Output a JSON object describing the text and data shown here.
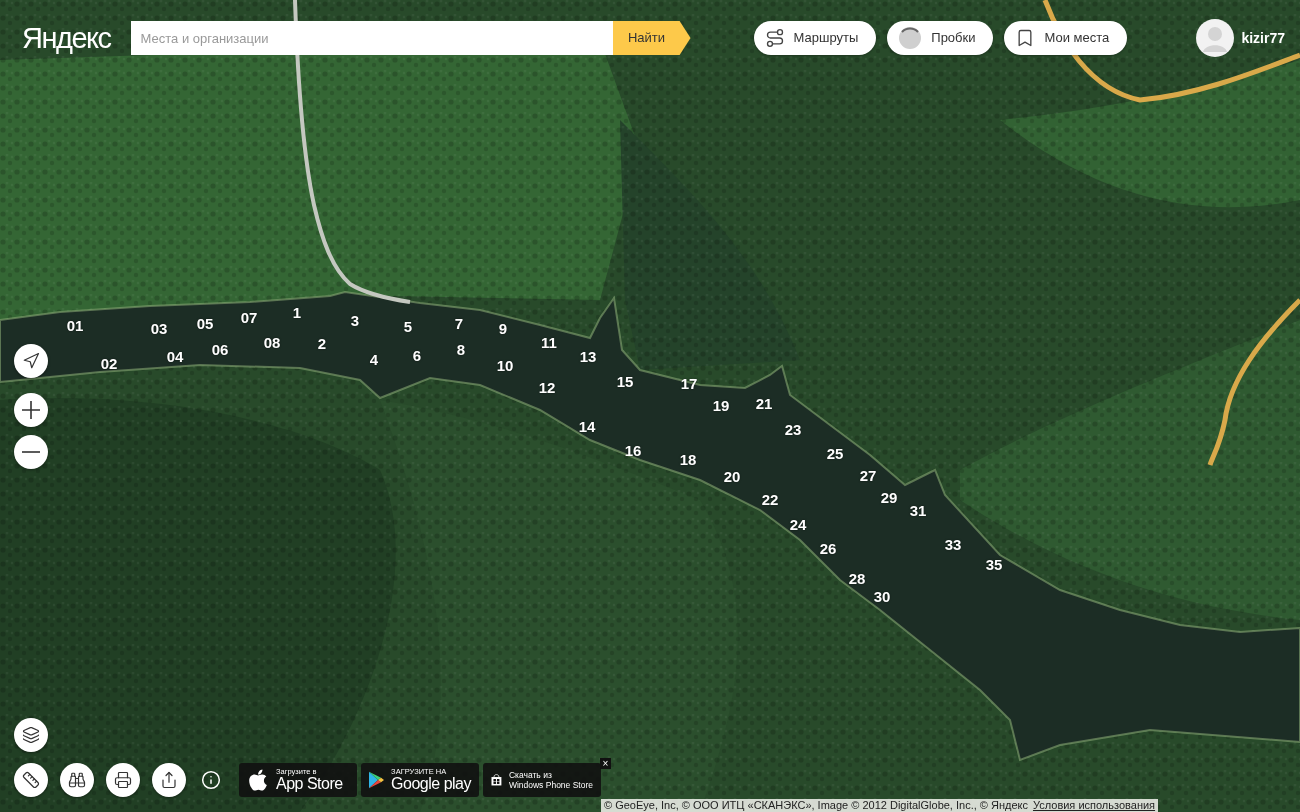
{
  "header": {
    "logo": "Яндекс",
    "search": {
      "placeholder": "Места и организации",
      "button": "Найти"
    },
    "buttons": [
      {
        "kind": "routes",
        "label": "Маршруты"
      },
      {
        "kind": "traffic",
        "label": "Пробки"
      },
      {
        "kind": "bookmarks",
        "label": "Мои места"
      }
    ],
    "user": {
      "name": "kizir77"
    }
  },
  "map_labels": [
    "01",
    "02",
    "03",
    "04",
    "05",
    "06",
    "07",
    "08",
    "1",
    "2",
    "3",
    "4",
    "5",
    "6",
    "7",
    "8",
    "9",
    "10",
    "11",
    "12",
    "13",
    "14",
    "15",
    "16",
    "17",
    "18",
    "19",
    "20",
    "21",
    "22",
    "23",
    "24",
    "25",
    "26",
    "27",
    "28",
    "29",
    "30",
    "31",
    "33",
    "35"
  ],
  "app_badges": [
    {
      "kind": "apple",
      "caption": "Загрузите в",
      "title": "App Store"
    },
    {
      "kind": "google",
      "caption": "ЗАГРУЗИТЕ НА",
      "title": "Google play"
    },
    {
      "kind": "windows",
      "caption": "Скачать из",
      "title": "Windows Phone Store"
    }
  ],
  "badges_close": "×",
  "attribution": {
    "text": "© GeoEye, Inc, © ООО ИТЦ «СКАНЭКС», Image © 2012 DigitalGlobe, Inc., © Яндекс",
    "link": "Условия использования"
  }
}
